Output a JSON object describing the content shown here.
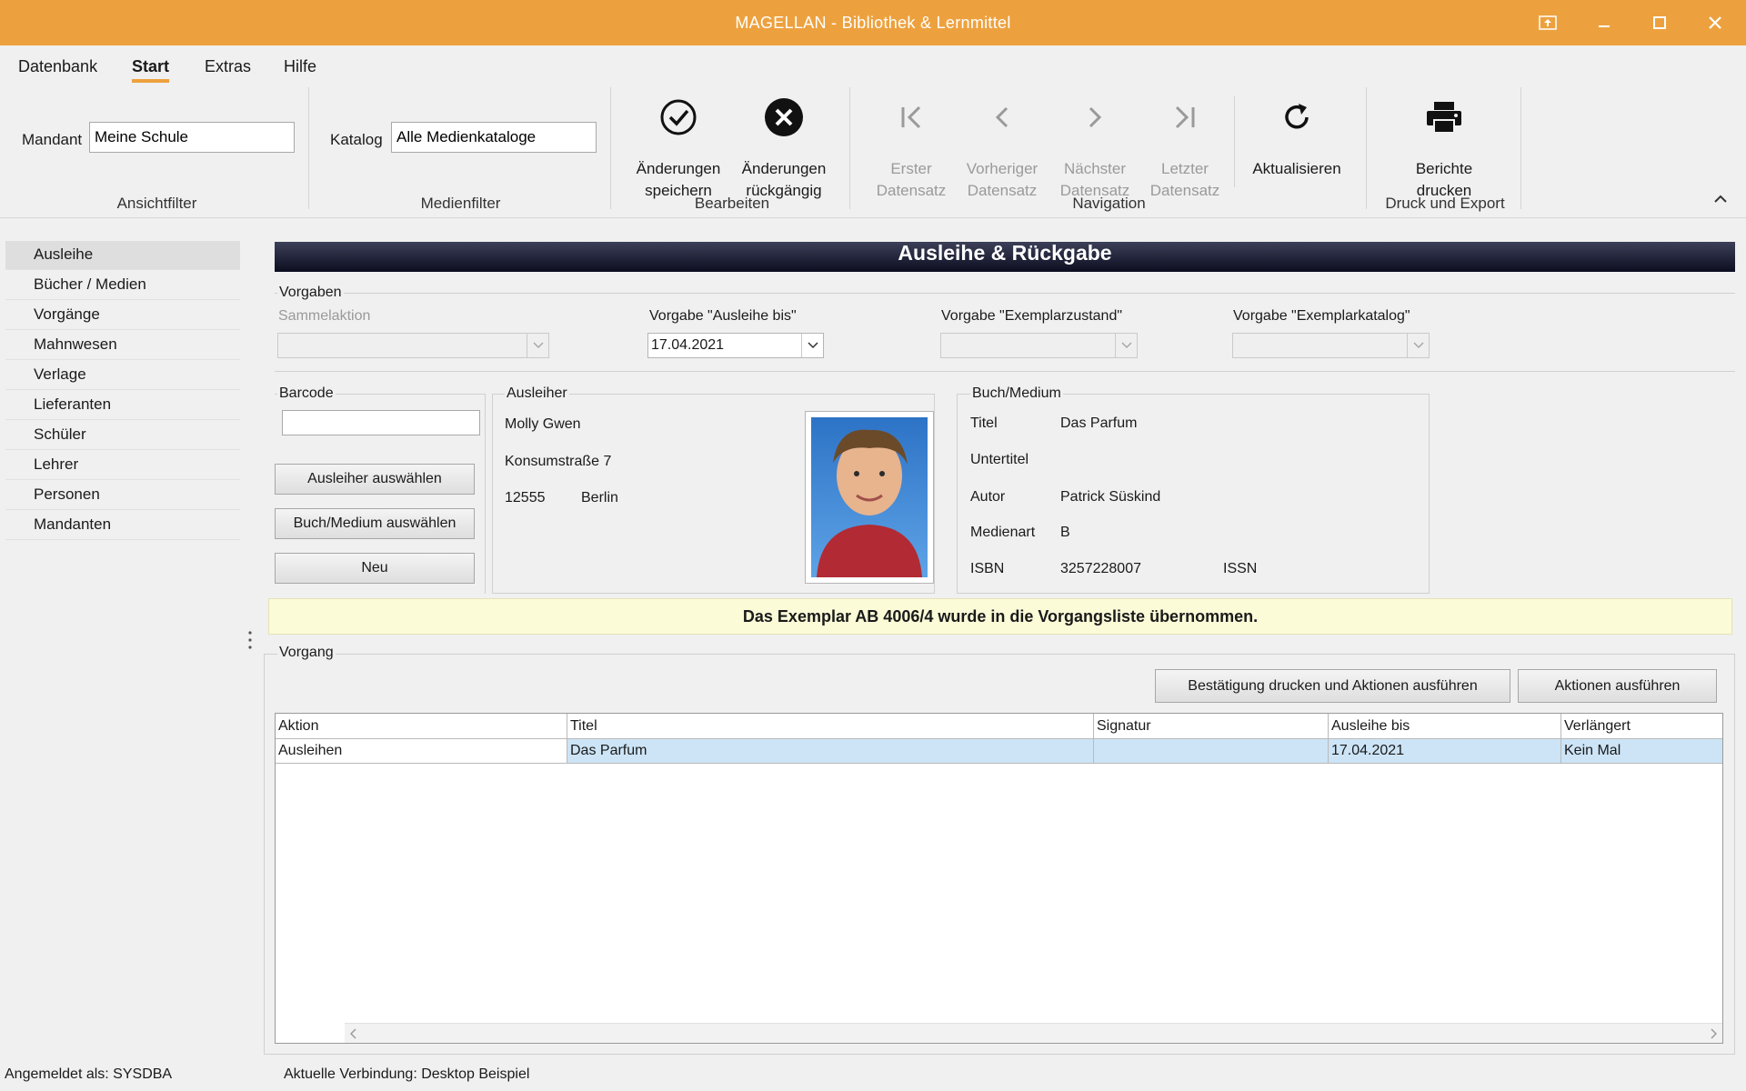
{
  "window": {
    "title": "MAGELLAN - Bibliothek & Lernmittel"
  },
  "ribbon_tabs": [
    "Datenbank",
    "Start",
    "Extras",
    "Hilfe"
  ],
  "ribbon": {
    "mandant_label": "Mandant",
    "mandant_value": "Meine Schule",
    "katalog_label": "Katalog",
    "katalog_value": "Alle Medienkataloge",
    "groups": {
      "ansichtfilter": "Ansichtfilter",
      "medienfilter": "Medienfilter",
      "bearbeiten": "Bearbeiten",
      "navigation": "Navigation",
      "druck": "Druck und Export"
    },
    "buttons": {
      "save": [
        "Änderungen",
        "speichern"
      ],
      "undo": [
        "Änderungen",
        "rückgängig"
      ],
      "first": [
        "Erster",
        "Datensatz"
      ],
      "prev": [
        "Vorheriger",
        "Datensatz"
      ],
      "next": [
        "Nächster",
        "Datensatz"
      ],
      "last": [
        "Letzter",
        "Datensatz"
      ],
      "refresh": [
        "Aktualisieren"
      ],
      "print": [
        "Berichte",
        "drucken"
      ]
    }
  },
  "sidebar": {
    "items": [
      "Ausleihe",
      "Bücher / Medien",
      "Vorgänge",
      "Mahnwesen",
      "Verlage",
      "Lieferanten",
      "Schüler",
      "Lehrer",
      "Personen",
      "Mandanten"
    ],
    "active": "Ausleihe"
  },
  "panel": {
    "title": "Ausleihe & Rückgabe",
    "vorgaben": {
      "title": "Vorgaben",
      "sammelaktion_label": "Sammelaktion",
      "ausleihe_bis_label": "Vorgabe \"Ausleihe bis\"",
      "ausleihe_bis_value": "17.04.2021",
      "zustand_label": "Vorgabe \"Exemplarzustand\"",
      "katalog_label": "Vorgabe \"Exemplarkatalog\""
    },
    "barcode": {
      "title": "Barcode",
      "btn_ausleiher": "Ausleiher auswählen",
      "btn_medium": "Buch/Medium auswählen",
      "btn_neu": "Neu"
    },
    "ausleiher": {
      "title": "Ausleiher",
      "name": "Molly Gwen",
      "street": "Konsumstraße 7",
      "zip": "12555",
      "city": "Berlin"
    },
    "medium": {
      "title": "Buch/Medium",
      "titel_label": "Titel",
      "titel_value": "Das Parfum",
      "untertitel_label": "Untertitel",
      "autor_label": "Autor",
      "autor_value": "Patrick Süskind",
      "medienart_label": "Medienart",
      "medienart_value": "B",
      "isbn_label": "ISBN",
      "isbn_value": "3257228007",
      "issn_label": "ISSN"
    },
    "notice": "Das Exemplar AB 4006/4 wurde in die Vorgangsliste übernommen.",
    "vorgang": {
      "title": "Vorgang",
      "btn_confirm": "Bestätigung drucken und Aktionen ausführen",
      "btn_actions": "Aktionen ausführen",
      "columns": [
        "Aktion",
        "Titel",
        "Signatur",
        "Ausleihe bis",
        "Verlängert"
      ],
      "rows": [
        [
          "Ausleihen",
          "Das Parfum",
          "",
          "17.04.2021",
          "Kein Mal"
        ]
      ]
    }
  },
  "statusbar": {
    "user": "Angemeldet als: SYSDBA",
    "connection": "Aktuelle Verbindung: Desktop Beispiel"
  },
  "colors": {
    "accent": "#eda13e",
    "header_dark": "#0c0e20",
    "selection": "#cce4f6",
    "notice_bg": "#fbfbd8"
  }
}
